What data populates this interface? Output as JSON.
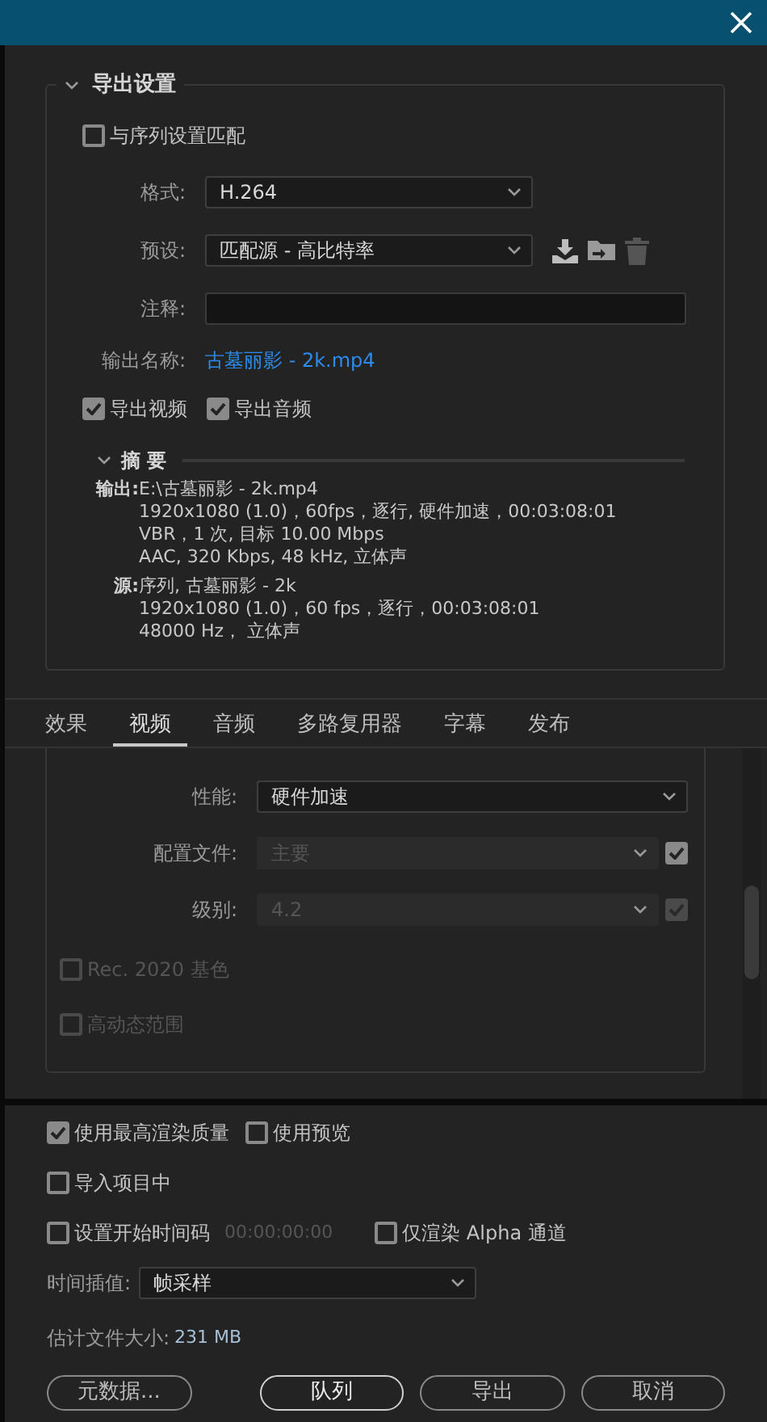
{
  "export_settings": {
    "title": "导出设置",
    "expanded": true,
    "match_sequence": {
      "label": "与序列设置匹配",
      "checked": false
    },
    "format": {
      "label": "格式:",
      "value": "H.264"
    },
    "preset": {
      "label": "预设:",
      "value": "匹配源 - 高比特率"
    },
    "comment": {
      "label": "注释:"
    },
    "output_name": {
      "label": "输出名称:",
      "value": "古墓丽影 - 2k.mp4"
    },
    "export_toggles": [
      {
        "label": "导出视频",
        "checked": true
      },
      {
        "label": "导出音频",
        "checked": true
      }
    ],
    "summary": {
      "title": "摘要",
      "expanded": true,
      "groups": [
        {
          "label": "输出:",
          "lines": [
            "E:\\古墓丽影 - 2k.mp4",
            "1920x1080 (1.0)，60fps，逐行, 硬件加速，00:03:08:01",
            "VBR，1 次, 目标 10.00 Mbps",
            "AAC, 320 Kbps, 48  kHz, 立体声"
          ]
        },
        {
          "label": "源:",
          "lines": [
            "序列, 古墓丽影 - 2k",
            "1920x1080 (1.0)，60 fps，逐行，00:03:08:01",
            "48000 Hz， 立体声"
          ]
        }
      ]
    }
  },
  "tabs": [
    {
      "label": "效果",
      "selected": false
    },
    {
      "label": "视频",
      "selected": true
    },
    {
      "label": "音频",
      "selected": false
    },
    {
      "label": "多路复用器",
      "selected": false
    },
    {
      "label": "字幕",
      "selected": false
    },
    {
      "label": "发布",
      "selected": false
    }
  ],
  "video_settings": {
    "fields": [
      {
        "label": "性能:",
        "value": "硬件加速",
        "disabled": false
      },
      {
        "label": "配置文件:",
        "value": "主要",
        "disabled": true,
        "lock": {
          "checked": true,
          "disabled": false
        }
      },
      {
        "label": "级别:",
        "value": "4.2",
        "disabled": true,
        "lock": {
          "checked": true,
          "disabled": true
        }
      }
    ],
    "checkboxes": [
      {
        "label": "Rec. 2020 基色",
        "checked": false,
        "disabled": true
      },
      {
        "label": "高动态范围",
        "checked": false,
        "disabled": true
      }
    ]
  },
  "options": {
    "max_quality": {
      "label": "使用最高渲染质量",
      "checked": true
    },
    "use_previews": {
      "label": "使用预览",
      "checked": false
    },
    "import_into_project": {
      "label": "导入项目中",
      "checked": false
    },
    "start_timecode": {
      "label": "设置开始时间码",
      "checked": false,
      "value": "00:00:00:00"
    },
    "alpha_only": {
      "label": "仅渲染 Alpha 通道",
      "checked": false
    }
  },
  "time_interpolation": {
    "label": "时间插值:",
    "value": "帧采样"
  },
  "estimated_size": {
    "label": "估计文件大小:",
    "value": "231 MB"
  },
  "buttons": [
    {
      "label": "元数据...",
      "default": false
    },
    {
      "label": "队列",
      "default": true
    },
    {
      "label": "导出",
      "default": false
    },
    {
      "label": "取消",
      "default": false
    }
  ]
}
